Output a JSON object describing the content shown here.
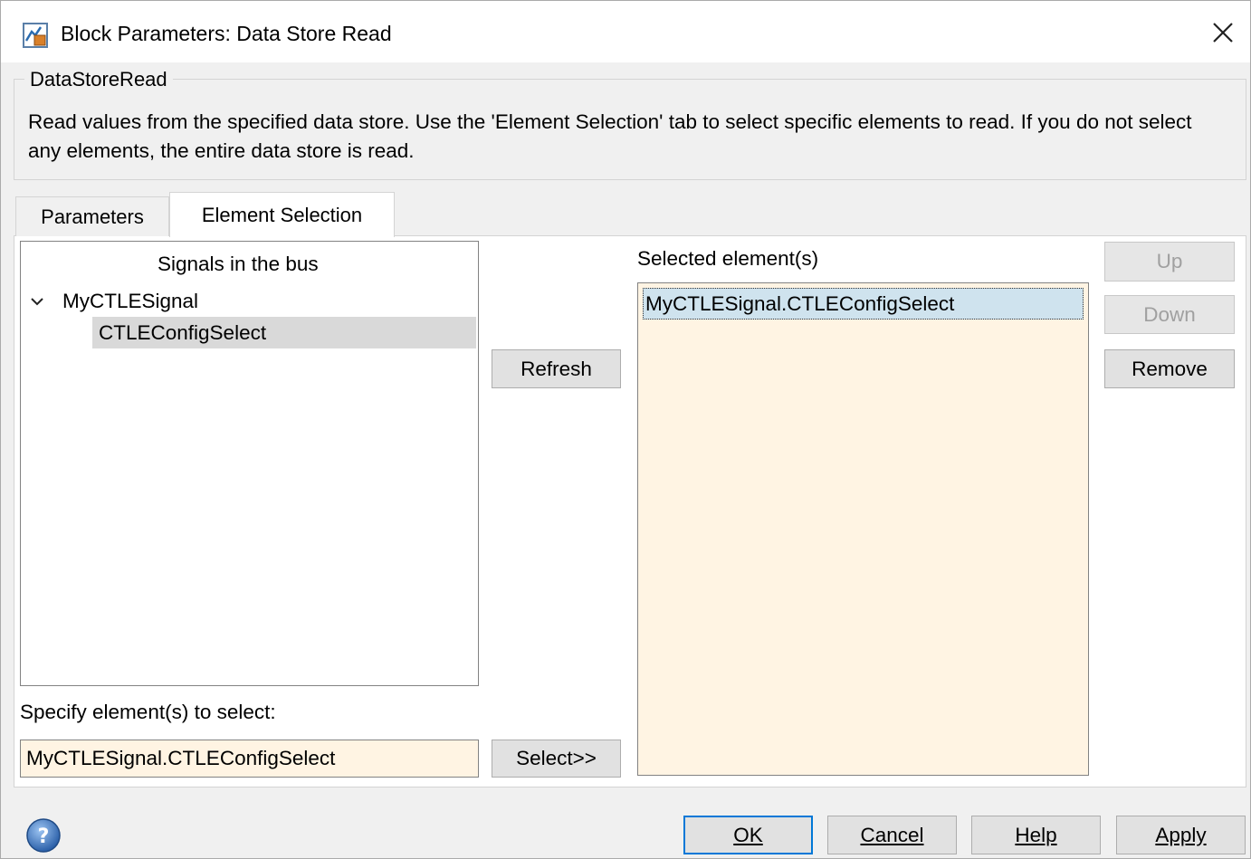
{
  "window": {
    "title": "Block Parameters: Data Store Read"
  },
  "block": {
    "type_name": "DataStoreRead",
    "description": "Read values from the specified data store. Use the 'Element Selection' tab to select specific elements to read. If you do not select any elements, the entire data store is read."
  },
  "tabs": [
    {
      "label": "Parameters",
      "active": false
    },
    {
      "label": "Element Selection",
      "active": true
    }
  ],
  "tree": {
    "header": "Signals in the bus",
    "parent": "MyCTLESignal",
    "child": "CTLEConfigSelect"
  },
  "buttons": {
    "refresh": "Refresh",
    "select": "Select>>",
    "up": "Up",
    "down": "Down",
    "remove": "Remove"
  },
  "selected": {
    "label": "Selected element(s)",
    "items": [
      "MyCTLESignal.CTLEConfigSelect"
    ]
  },
  "specify": {
    "label": "Specify element(s) to select:",
    "value": "MyCTLESignal.CTLEConfigSelect"
  },
  "footer": {
    "ok": "OK",
    "cancel": "Cancel",
    "help": "Help",
    "apply": "Apply"
  },
  "colors": {
    "input_bg": "#fff4e3",
    "selected_bg": "#cfe3ee",
    "default_border": "#0078d7"
  }
}
